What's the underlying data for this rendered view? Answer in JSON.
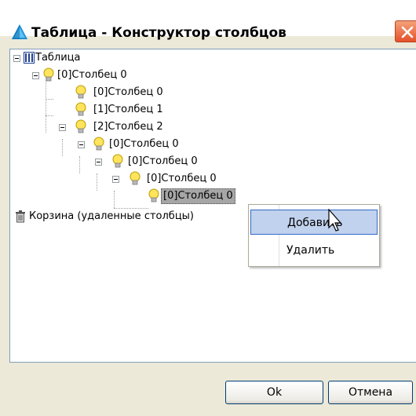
{
  "window": {
    "title": "Таблица - Конструктор столбцов",
    "title_icon": "app-triangle-icon",
    "close_icon": "close-icon",
    "colors": {
      "accent": "#316ac5",
      "close": "#e4512a",
      "face": "#ece9d8"
    }
  },
  "tree": {
    "root_label": "Таблица",
    "nodes": [
      {
        "label": "[0]Столбец 0"
      },
      {
        "label": "[0]Столбец 0"
      },
      {
        "label": "[1]Столбец 1"
      },
      {
        "label": "[2]Столбец 2"
      },
      {
        "label": "[0]Столбец 0"
      },
      {
        "label": "[0]Столбец 0"
      },
      {
        "label": "[0]Столбец 0"
      },
      {
        "label": "[0]Столбец 0",
        "selected": true
      }
    ],
    "trash_label": "Корзина (удаленные столбцы)",
    "node_icon": "bulb-icon",
    "trash_icon": "trash-icon"
  },
  "context_menu": {
    "items": [
      {
        "label": "Добавить",
        "hovered": true
      },
      {
        "label": "Удалить"
      }
    ]
  },
  "buttons": {
    "ok": "Ok",
    "cancel": "Отмена"
  }
}
